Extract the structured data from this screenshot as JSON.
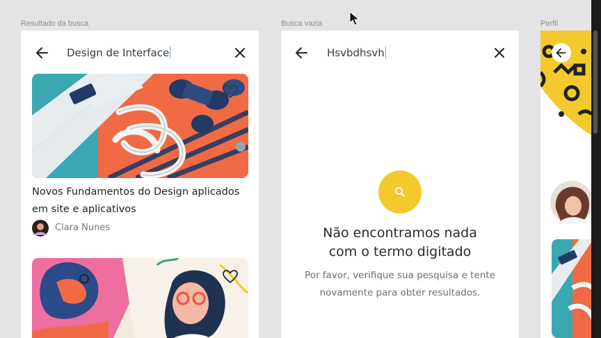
{
  "frames": [
    {
      "label": "Resultado da busca",
      "search_value": "Design de Interface",
      "card": {
        "title_line1": "Novos Fundamentos do Design aplicados",
        "title_line2": "em site e aplicativos",
        "author": "Clara Nunes"
      }
    },
    {
      "label": "Busca vazia",
      "search_value": "Hsvbdhsvh",
      "empty_title_line1": "Não encontramos nada",
      "empty_title_line2": "com o termo digitado",
      "empty_desc_line1": "Por favor, verifique sua pesquisa e tente",
      "empty_desc_line2": "novamente para obter resultados."
    },
    {
      "label": "Perfil"
    }
  ],
  "colors": {
    "canvas": "#e4e4e6",
    "accent_yellow": "#f4c92d",
    "coral": "#f06a45",
    "navy": "#223a66",
    "teal": "#3aa8b2"
  },
  "icons": [
    "back-arrow-icon",
    "close-icon",
    "heart-icon",
    "search-icon",
    "mouse-cursor-icon"
  ]
}
